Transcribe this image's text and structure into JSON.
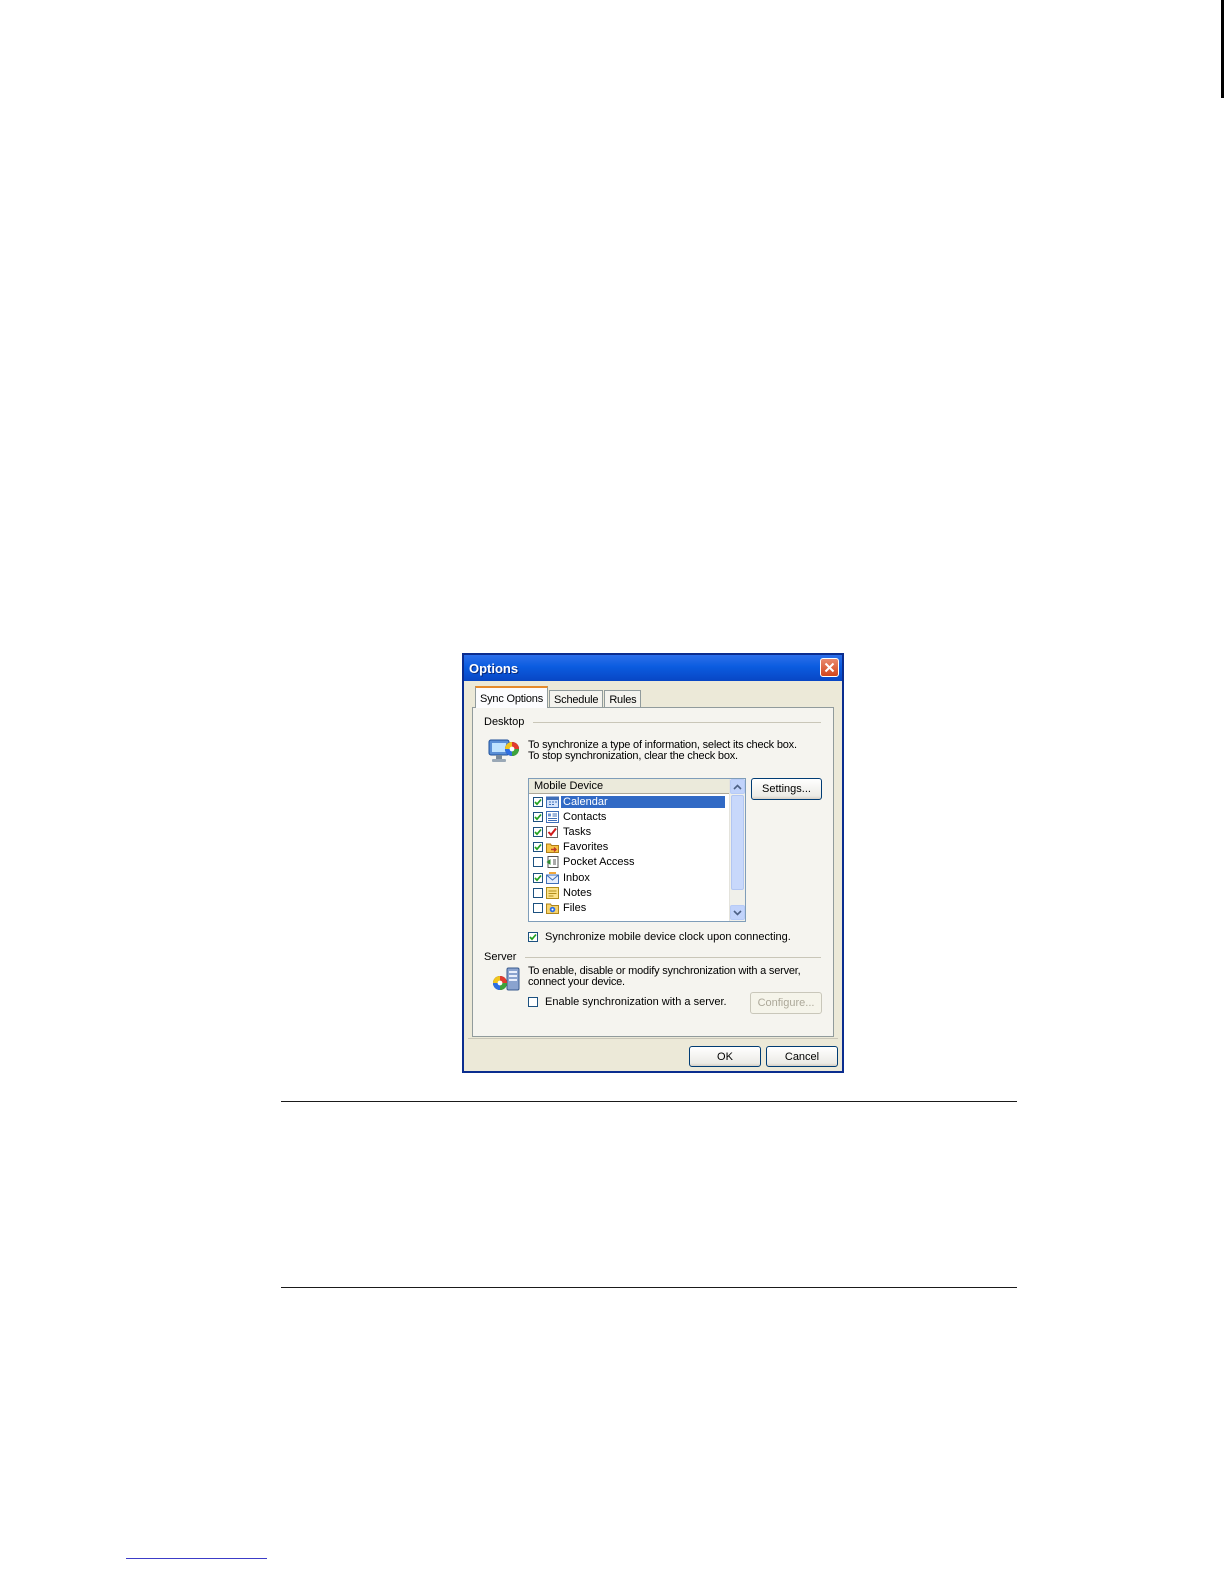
{
  "window": {
    "title": "Options"
  },
  "tabs": [
    {
      "label": "Sync Options",
      "active": true
    },
    {
      "label": "Schedule",
      "active": false
    },
    {
      "label": "Rules",
      "active": false
    }
  ],
  "desktop": {
    "label": "Desktop",
    "instructions": [
      "To synchronize a type of information, select its check box.",
      "To stop synchronization, clear the check box."
    ],
    "list_header": "Mobile Device",
    "items": [
      {
        "label": "Calendar",
        "checked": true,
        "selected": true,
        "icon": "calendar-icon"
      },
      {
        "label": "Contacts",
        "checked": true,
        "selected": false,
        "icon": "contacts-icon"
      },
      {
        "label": "Tasks",
        "checked": true,
        "selected": false,
        "icon": "tasks-icon"
      },
      {
        "label": "Favorites",
        "checked": true,
        "selected": false,
        "icon": "favorites-icon"
      },
      {
        "label": "Pocket Access",
        "checked": false,
        "selected": false,
        "icon": "pocket-access-icon"
      },
      {
        "label": "Inbox",
        "checked": true,
        "selected": false,
        "icon": "inbox-icon"
      },
      {
        "label": "Notes",
        "checked": false,
        "selected": false,
        "icon": "notes-icon"
      },
      {
        "label": "Files",
        "checked": false,
        "selected": false,
        "icon": "files-icon"
      }
    ],
    "settings_button": "Settings...",
    "clock_sync_label": "Synchronize mobile device clock upon connecting.",
    "clock_sync_checked": true
  },
  "server": {
    "label": "Server",
    "instructions": [
      "To enable, disable or modify synchronization with a server,",
      "connect your device."
    ],
    "enable_label": "Enable synchronization with a server.",
    "enable_checked": false,
    "configure_button": "Configure..."
  },
  "buttons": {
    "ok": "OK",
    "cancel": "Cancel"
  },
  "colors": {
    "titlebar": "#0b5ce0",
    "selection": "#316ac5",
    "dialog_bg": "#ece9d8",
    "close_button": "#d2451c"
  }
}
